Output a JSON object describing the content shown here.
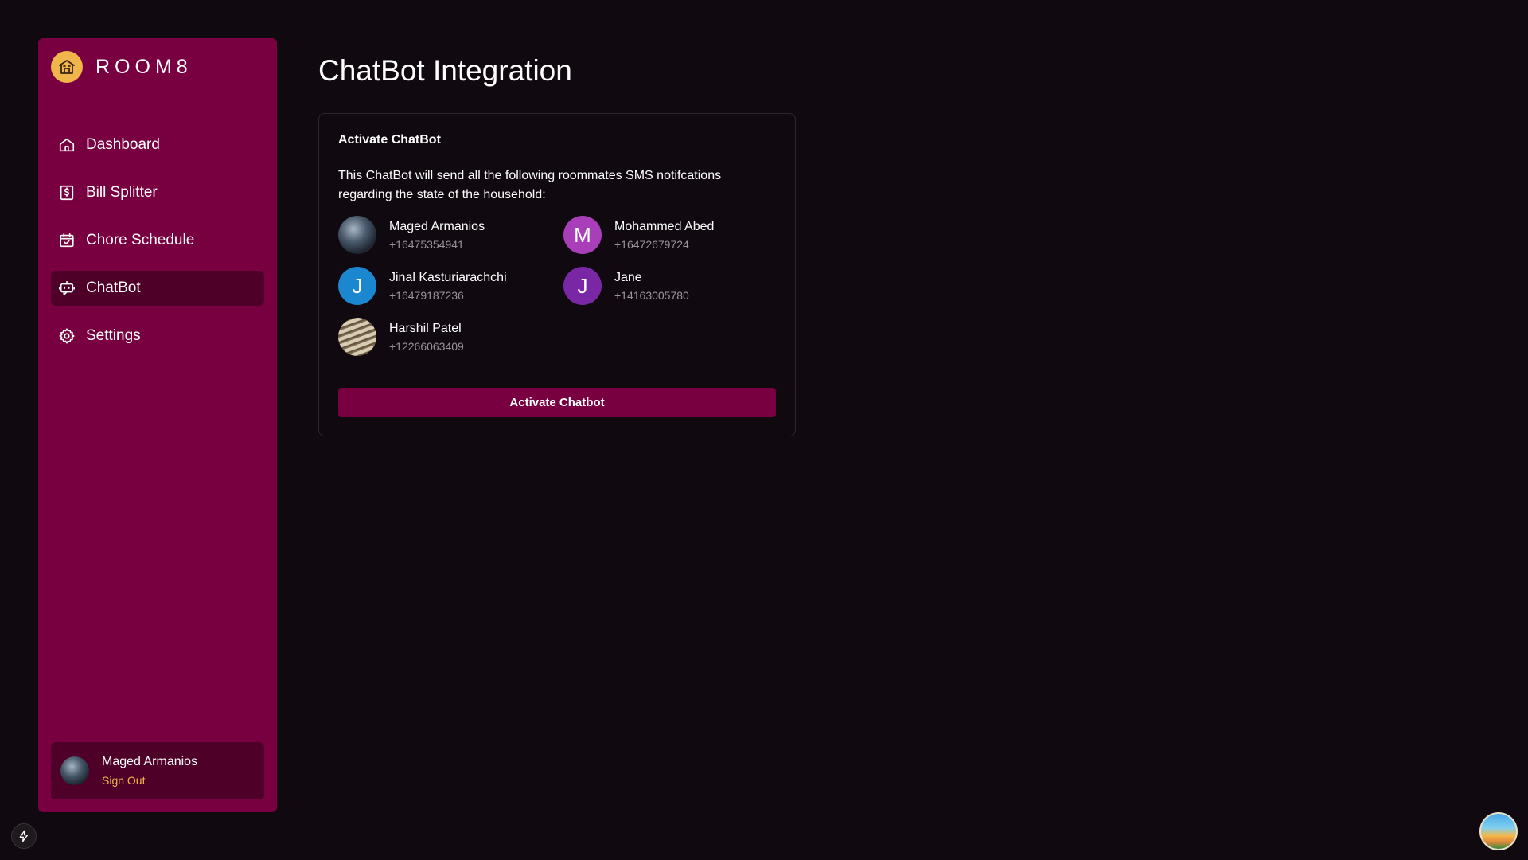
{
  "app": {
    "name": "ROOM8",
    "logo_icon": "house-building-icon"
  },
  "sidebar": {
    "items": [
      {
        "label": "Dashboard",
        "icon": "home-icon",
        "active": false
      },
      {
        "label": "Bill Splitter",
        "icon": "receipt-dollar-icon",
        "active": false
      },
      {
        "label": "Chore Schedule",
        "icon": "calendar-check-icon",
        "active": false
      },
      {
        "label": "ChatBot",
        "icon": "chatbot-icon",
        "active": true
      },
      {
        "label": "Settings",
        "icon": "gear-icon",
        "active": false
      }
    ],
    "user": {
      "name": "Maged Armanios",
      "signout_label": "Sign Out"
    }
  },
  "main": {
    "title": "ChatBot Integration",
    "card": {
      "title": "Activate ChatBot",
      "description": "This ChatBot will send all the following roommates SMS notifcations regarding the state of the household:",
      "members": [
        {
          "name": "Maged Armanios",
          "phone": "+16475354941",
          "initial": "",
          "photo": true,
          "color": ""
        },
        {
          "name": "Mohammed Abed",
          "phone": "+16472679724",
          "initial": "M",
          "photo": false,
          "color": "#a93fb8"
        },
        {
          "name": "Jinal Kasturiarachchi",
          "phone": "+16479187236",
          "initial": "J",
          "photo": false,
          "color": "#1a87cf"
        },
        {
          "name": "Jane",
          "phone": "+14163005780",
          "initial": "J",
          "photo": false,
          "color": "#7a27a6"
        },
        {
          "name": "Harshil Patel",
          "phone": "+12266063409",
          "initial": "",
          "photo": true,
          "color": ""
        }
      ],
      "button_label": "Activate Chatbot"
    }
  },
  "colors": {
    "background": "#100a10",
    "sidebar": "#780040",
    "sidebar_active": "#4f0029",
    "accent": "#f0b64c"
  }
}
